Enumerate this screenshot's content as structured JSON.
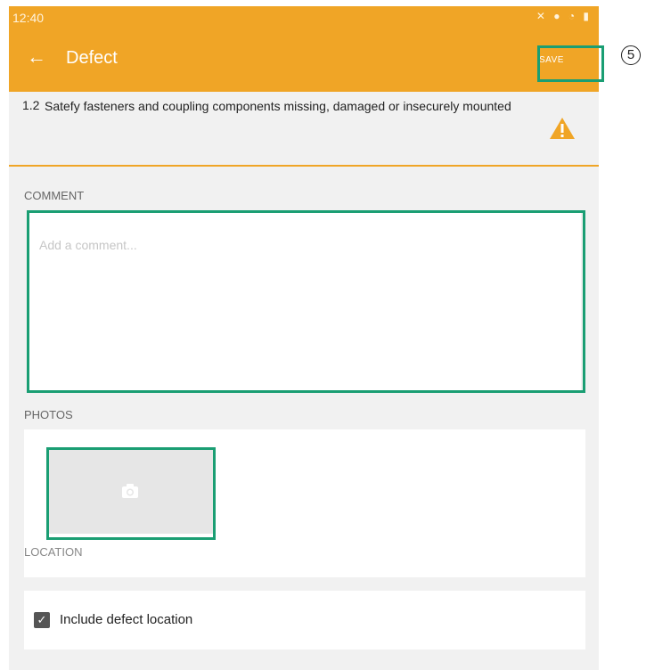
{
  "status_bar": {
    "time": "12:40",
    "icons": [
      "nfc-icon",
      "battery-saver-icon",
      "mute-icon",
      "location-icon",
      "wifi-icon",
      "signal-icon",
      "battery-icon"
    ]
  },
  "appbar": {
    "title": "Defect",
    "save_label": "SAVE",
    "back_icon": "arrow-left-icon"
  },
  "defect": {
    "number": "1.2",
    "text": "Satefy fasteners and coupling components missing, damaged or insecurely mounted",
    "warning_icon": "warning-triangle-icon"
  },
  "comment": {
    "label": "COMMENT",
    "placeholder": "Add a comment..."
  },
  "photos": {
    "label": "PHOTOS",
    "add_icon": "camera-icon"
  },
  "location": {
    "label": "LOCATION",
    "checkbox_label": "Include defect location",
    "checked": true
  },
  "annotation": {
    "step": "5"
  },
  "colors": {
    "accent": "#f0a526",
    "highlight": "#1a9e73"
  }
}
